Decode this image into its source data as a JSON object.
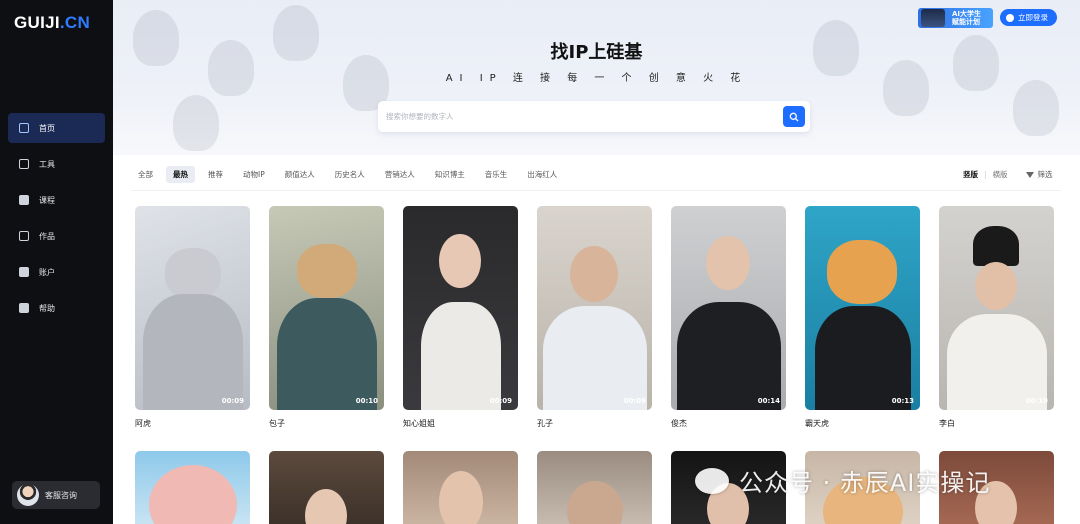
{
  "logo": {
    "main": "GUIJI",
    "dot": ".CN"
  },
  "nav": [
    {
      "label": "首页",
      "active": true
    },
    {
      "label": "工具",
      "active": false
    },
    {
      "label": "课程",
      "active": false
    },
    {
      "label": "作品",
      "active": false
    },
    {
      "label": "账户",
      "active": false
    },
    {
      "label": "帮助",
      "active": false
    }
  ],
  "service": {
    "label": "客服咨询"
  },
  "header": {
    "badge_line1": "AI大学生",
    "badge_line2": "赋能计划",
    "login_label": "立即登录"
  },
  "hero": {
    "title": "找IP上硅基",
    "subtitle": "AI IP 连 接 每 一 个 创 意 火 花"
  },
  "search": {
    "placeholder": "搜索你想要的数字人"
  },
  "filters": [
    "全部",
    "最热",
    "推荐",
    "动物IP",
    "颜值达人",
    "历史名人",
    "营销达人",
    "知识博主",
    "音乐生",
    "出海红人"
  ],
  "active_filter": "最热",
  "view": {
    "vertical": "竖版",
    "horizontal": "横版",
    "filter": "筛选"
  },
  "cards": [
    {
      "name": "阿虎",
      "duration": "00:09"
    },
    {
      "name": "包子",
      "duration": "00:10"
    },
    {
      "name": "知心姐姐",
      "duration": "00:09"
    },
    {
      "name": "孔子",
      "duration": "00:09"
    },
    {
      "name": "俊杰",
      "duration": "00:14"
    },
    {
      "name": "霸天虎",
      "duration": "00:13"
    },
    {
      "name": "李白",
      "duration": "00:19"
    }
  ],
  "watermark": "公众号 · 赤辰AI实操记"
}
